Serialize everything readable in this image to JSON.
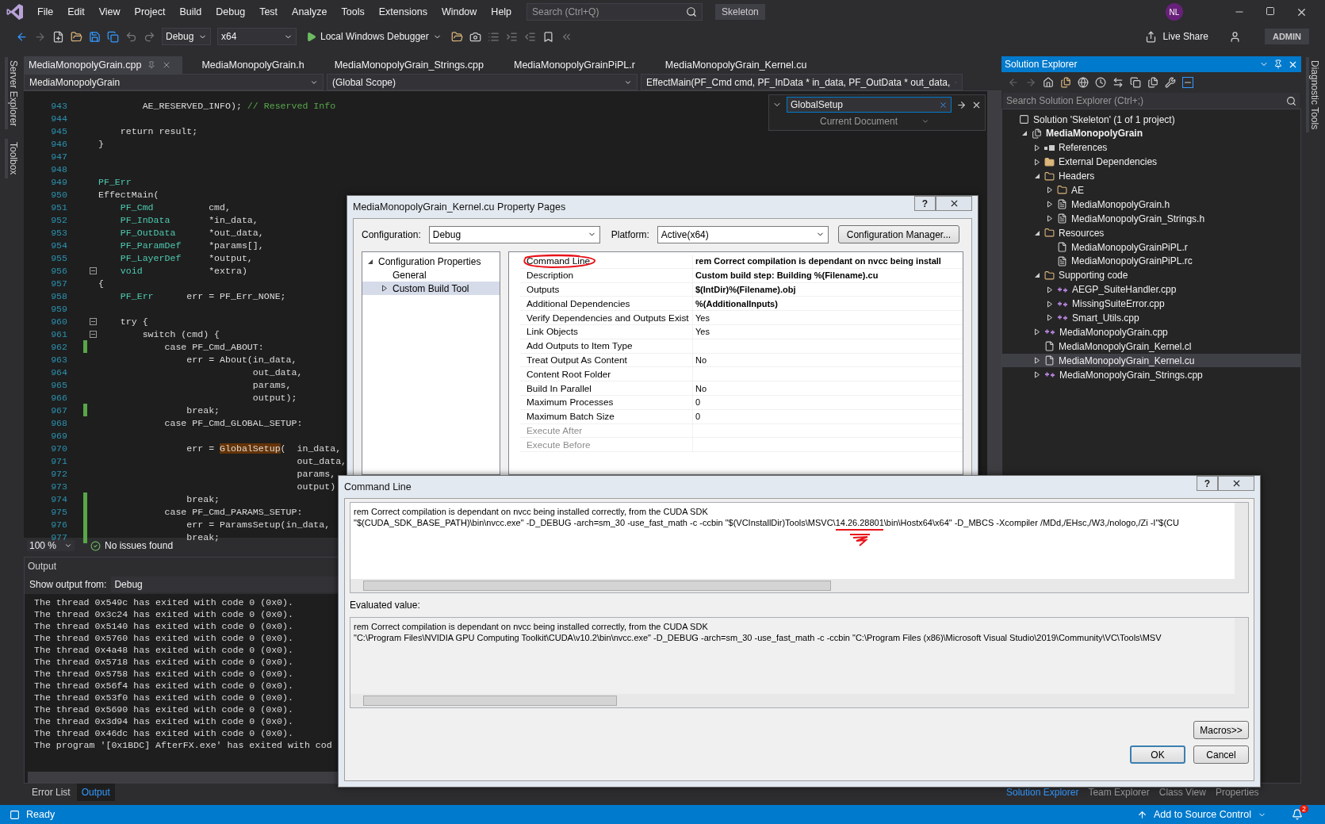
{
  "menu": [
    "File",
    "Edit",
    "View",
    "Project",
    "Build",
    "Debug",
    "Test",
    "Analyze",
    "Tools",
    "Extensions",
    "Window",
    "Help"
  ],
  "search": {
    "placeholder": "Search (Ctrl+Q)"
  },
  "solution_name": "Skeleton",
  "user_initials": "NL",
  "toolbar": {
    "configuration": "Debug",
    "platform": "x64",
    "debugger": "Local Windows Debugger",
    "live_share": "Live Share",
    "account": "ADMIN"
  },
  "left_rail": [
    "Server Explorer",
    "Toolbox"
  ],
  "right_rail": [
    "Diagnostic Tools"
  ],
  "editor_tabs": [
    {
      "label": "MediaMonopolyGrain.cpp",
      "selected": true
    },
    {
      "label": "MediaMonopolyGrain.h",
      "selected": false
    },
    {
      "label": "MediaMonopolyGrain_Strings.cpp",
      "selected": false
    },
    {
      "label": "MediaMonopolyGrainPiPL.r",
      "selected": false
    },
    {
      "label": "MediaMonopolyGrain_Kernel.cu",
      "selected": false
    }
  ],
  "nav_bar": {
    "project": "MediaMonopolyGrain",
    "scope": "(Global Scope)",
    "member": "EffectMain(PF_Cmd cmd, PF_InData * in_data, PF_OutData * out_data,"
  },
  "find": {
    "value": "GlobalSetup",
    "scope": "Current Document"
  },
  "code_lines": [
    {
      "number": "943",
      "fold": false,
      "changed": false,
      "segments": [
        {
          "kind": "plain",
          "text": "        AE_RESERVED_INFO); "
        },
        {
          "kind": "comment",
          "text": "// Reserved Info"
        }
      ]
    },
    {
      "number": "944",
      "fold": false,
      "changed": false
    },
    {
      "number": "945",
      "fold": false,
      "changed": false,
      "segments": [
        {
          "kind": "plain",
          "text": "    return result;"
        }
      ]
    },
    {
      "number": "946",
      "fold": false,
      "changed": false,
      "segments": [
        {
          "kind": "plain",
          "text": "}"
        }
      ]
    },
    {
      "number": "947",
      "fold": false,
      "changed": false
    },
    {
      "number": "948",
      "fold": false,
      "changed": false
    },
    {
      "number": "949",
      "fold": false,
      "changed": false,
      "segments": [
        {
          "kind": "type",
          "text": "PF_Err"
        }
      ]
    },
    {
      "number": "950",
      "fold": false,
      "changed": false,
      "segments": [
        {
          "kind": "plain",
          "text": "EffectMain("
        }
      ]
    },
    {
      "number": "951",
      "fold": false,
      "changed": false,
      "segments": [
        {
          "kind": "type",
          "text": "    PF_Cmd"
        },
        {
          "kind": "plain",
          "text": "          cmd,"
        }
      ]
    },
    {
      "number": "952",
      "fold": false,
      "changed": false,
      "segments": [
        {
          "kind": "type",
          "text": "    PF_InData"
        },
        {
          "kind": "plain",
          "text": "       *in_data,"
        }
      ]
    },
    {
      "number": "953",
      "fold": false,
      "changed": false,
      "segments": [
        {
          "kind": "type",
          "text": "    PF_OutData"
        },
        {
          "kind": "plain",
          "text": "      *out_data,"
        }
      ]
    },
    {
      "number": "954",
      "fold": false,
      "changed": false,
      "segments": [
        {
          "kind": "type",
          "text": "    PF_ParamDef"
        },
        {
          "kind": "plain",
          "text": "     *params[],"
        }
      ]
    },
    {
      "number": "955",
      "fold": false,
      "changed": false,
      "segments": [
        {
          "kind": "type",
          "text": "    PF_LayerDef"
        },
        {
          "kind": "plain",
          "text": "     *output,"
        }
      ]
    },
    {
      "number": "956",
      "fold": true,
      "changed": false,
      "segments": [
        {
          "kind": "type",
          "text": "    void"
        },
        {
          "kind": "plain",
          "text": "            *extra)"
        }
      ]
    },
    {
      "number": "957",
      "fold": false,
      "changed": false,
      "segments": [
        {
          "kind": "plain",
          "text": "{"
        }
      ]
    },
    {
      "number": "958",
      "fold": false,
      "changed": false,
      "segments": [
        {
          "kind": "type",
          "text": "    PF_Err"
        },
        {
          "kind": "plain",
          "text": "      err = PF_Err_NONE;"
        }
      ]
    },
    {
      "number": "959",
      "fold": false,
      "changed": false
    },
    {
      "number": "960",
      "fold": true,
      "changed": false,
      "segments": [
        {
          "kind": "plain",
          "text": "    try {"
        }
      ]
    },
    {
      "number": "961",
      "fold": true,
      "changed": false,
      "segments": [
        {
          "kind": "plain",
          "text": "        switch (cmd) {"
        }
      ]
    },
    {
      "number": "962",
      "fold": false,
      "changed": true,
      "segments": [
        {
          "kind": "plain",
          "text": "            case PF_Cmd_ABOUT:"
        }
      ]
    },
    {
      "number": "963",
      "fold": false,
      "changed": false,
      "segments": [
        {
          "kind": "plain",
          "text": "                err = About(in_data,"
        }
      ]
    },
    {
      "number": "964",
      "fold": false,
      "changed": false,
      "segments": [
        {
          "kind": "plain",
          "text": "                            out_data,"
        }
      ]
    },
    {
      "number": "965",
      "fold": false,
      "changed": false,
      "segments": [
        {
          "kind": "plain",
          "text": "                            params,"
        }
      ]
    },
    {
      "number": "966",
      "fold": false,
      "changed": false,
      "segments": [
        {
          "kind": "plain",
          "text": "                            output);"
        }
      ]
    },
    {
      "number": "967",
      "fold": false,
      "changed": true,
      "segments": [
        {
          "kind": "plain",
          "text": "                break;"
        }
      ]
    },
    {
      "number": "968",
      "fold": false,
      "changed": false,
      "segments": [
        {
          "kind": "plain",
          "text": "            case PF_Cmd_GLOBAL_SETUP:"
        }
      ]
    },
    {
      "number": "969",
      "fold": false,
      "changed": false
    },
    {
      "number": "970",
      "fold": false,
      "changed": false,
      "segments": [
        {
          "kind": "plain",
          "text": "                err = "
        },
        {
          "kind": "match",
          "text": "GlobalSetup"
        },
        {
          "kind": "plain",
          "text": "(  in_data,"
        }
      ]
    },
    {
      "number": "971",
      "fold": false,
      "changed": false,
      "segments": [
        {
          "kind": "plain",
          "text": "                                    out_data,"
        }
      ]
    },
    {
      "number": "972",
      "fold": false,
      "changed": false,
      "segments": [
        {
          "kind": "plain",
          "text": "                                    params,"
        }
      ]
    },
    {
      "number": "973",
      "fold": false,
      "changed": false,
      "segments": [
        {
          "kind": "plain",
          "text": "                                    output)"
        }
      ]
    },
    {
      "number": "974",
      "fold": false,
      "changed": true,
      "segments": [
        {
          "kind": "plain",
          "text": "                break;"
        }
      ]
    },
    {
      "number": "975",
      "fold": false,
      "changed": true,
      "segments": [
        {
          "kind": "plain",
          "text": "            case PF_Cmd_PARAMS_SETUP:"
        }
      ]
    },
    {
      "number": "976",
      "fold": false,
      "changed": true,
      "segments": [
        {
          "kind": "plain",
          "text": "                err = ParamsSetup(in_data,"
        }
      ]
    },
    {
      "number": "977",
      "fold": false,
      "changed": true,
      "segments": [
        {
          "kind": "plain",
          "text": "                break;"
        }
      ]
    }
  ],
  "editor_status": {
    "zoom": "100 %",
    "issues": "No issues found"
  },
  "output": {
    "title": "Output",
    "source_label": "Show output from:",
    "source": "Debug",
    "lines": [
      "The thread 0x549c has exited with code 0 (0x0).",
      "The thread 0x3c24 has exited with code 0 (0x0).",
      "The thread 0x5140 has exited with code 0 (0x0).",
      "The thread 0x5760 has exited with code 0 (0x0).",
      "The thread 0x4a48 has exited with code 0 (0x0).",
      "The thread 0x5718 has exited with code 0 (0x0).",
      "The thread 0x5758 has exited with code 0 (0x0).",
      "The thread 0x56f4 has exited with code 0 (0x0).",
      "The thread 0x53f0 has exited with code 0 (0x0).",
      "The thread 0x5690 has exited with code 0 (0x0).",
      "The thread 0x3d94 has exited with code 0 (0x0).",
      "The thread 0x46dc has exited with code 0 (0x0).",
      "The program '[0x1BDC] AfterFX.exe' has exited with cod"
    ]
  },
  "bottom_tabs": [
    {
      "label": "Error List",
      "selected": false
    },
    {
      "label": "Output",
      "selected": true
    }
  ],
  "solution_explorer": {
    "title": "Solution Explorer",
    "search_placeholder": "Search Solution Explorer (Ctrl+;)",
    "tree": [
      {
        "label": "Solution 'Skeleton' (1 of 1 project)",
        "kind": "solution",
        "expandable": false,
        "selected": false,
        "children": [
          {
            "label": "MediaMonopolyGrain",
            "kind": "project",
            "expandable": true,
            "expanded": true,
            "selected": false,
            "children": [
              {
                "label": "References",
                "kind": "references",
                "expandable": true,
                "expanded": false,
                "selected": false
              },
              {
                "label": "External Dependencies",
                "kind": "dependencies",
                "expandable": true,
                "expanded": false,
                "selected": false
              },
              {
                "label": "Headers",
                "kind": "filter",
                "expandable": true,
                "expanded": true,
                "selected": false,
                "children": [
                  {
                    "label": "AE",
                    "kind": "filter",
                    "expandable": true,
                    "expanded": false,
                    "selected": false
                  },
                  {
                    "label": "MediaMonopolyGrain.h",
                    "kind": "header",
                    "expandable": true,
                    "expanded": false,
                    "selected": false
                  },
                  {
                    "label": "MediaMonopolyGrain_Strings.h",
                    "kind": "header",
                    "expandable": true,
                    "expanded": false,
                    "selected": false
                  }
                ]
              },
              {
                "label": "Resources",
                "kind": "filter",
                "expandable": true,
                "expanded": true,
                "selected": false,
                "children": [
                  {
                    "label": "MediaMonopolyGrainPiPL.r",
                    "kind": "file",
                    "expandable": false,
                    "selected": false
                  },
                  {
                    "label": "MediaMonopolyGrainPiPL.rc",
                    "kind": "resource",
                    "expandable": false,
                    "selected": false
                  }
                ]
              },
              {
                "label": "Supporting code",
                "kind": "filter",
                "expandable": true,
                "expanded": true,
                "selected": false,
                "children": [
                  {
                    "label": "AEGP_SuiteHandler.cpp",
                    "kind": "cpp",
                    "expandable": true,
                    "expanded": false,
                    "selected": false
                  },
                  {
                    "label": "MissingSuiteError.cpp",
                    "kind": "cpp",
                    "expandable": true,
                    "expanded": false,
                    "selected": false
                  },
                  {
                    "label": "Smart_Utils.cpp",
                    "kind": "cpp",
                    "expandable": true,
                    "expanded": false,
                    "selected": false
                  }
                ]
              },
              {
                "label": "MediaMonopolyGrain.cpp",
                "kind": "cpp",
                "expandable": true,
                "expanded": false,
                "selected": false
              },
              {
                "label": "MediaMonopolyGrain_Kernel.cl",
                "kind": "file",
                "expandable": false,
                "selected": false
              },
              {
                "label": "MediaMonopolyGrain_Kernel.cu",
                "kind": "file",
                "expandable": true,
                "expanded": false,
                "selected": true
              },
              {
                "label": "MediaMonopolyGrain_Strings.cpp",
                "kind": "cpp",
                "expandable": true,
                "expanded": false,
                "selected": false
              }
            ]
          }
        ]
      }
    ]
  },
  "side_tabs": [
    {
      "label": "Solution Explorer",
      "selected": true
    },
    {
      "label": "Team Explorer",
      "selected": false
    },
    {
      "label": "Class View",
      "selected": false
    },
    {
      "label": "Properties",
      "selected": false
    }
  ],
  "status_bar": {
    "text": "Ready",
    "source_control": "Add to Source Control",
    "notifications": "2"
  },
  "property_pages": {
    "title": "MediaMonopolyGrain_Kernel.cu Property Pages",
    "help": "?",
    "configuration_label": "Configuration:",
    "configuration": "Debug",
    "platform_label": "Platform:",
    "platform": "Active(x64)",
    "manager_button": "Configuration Manager...",
    "tree": [
      {
        "label": "Configuration Properties",
        "expandable": true,
        "expanded": true,
        "selected": false,
        "children": [
          {
            "label": "General",
            "expandable": false,
            "selected": false
          },
          {
            "label": "Custom Build Tool",
            "expandable": true,
            "expanded": false,
            "selected": true
          }
        ]
      }
    ],
    "properties": [
      {
        "name": "Command Line",
        "value": "rem Correct compilation is dependant on nvcc being install",
        "bold": true,
        "disabled": false,
        "circled": true
      },
      {
        "name": "Description",
        "value": "Custom build step: Building %(Filename).cu",
        "bold": true,
        "disabled": false,
        "circled": false
      },
      {
        "name": "Outputs",
        "value": "$(IntDir)%(Filename).obj",
        "bold": true,
        "disabled": false,
        "circled": false
      },
      {
        "name": "Additional Dependencies",
        "value": "%(AdditionalInputs)",
        "bold": true,
        "disabled": false,
        "circled": false
      },
      {
        "name": "Verify Dependencies and Outputs Exist",
        "value": "Yes",
        "bold": false,
        "disabled": false,
        "circled": false
      },
      {
        "name": "Link Objects",
        "value": "Yes",
        "bold": false,
        "disabled": false,
        "circled": false
      },
      {
        "name": "Add Outputs to Item Type",
        "disabled": false,
        "circled": false
      },
      {
        "name": "Treat Output As Content",
        "value": "No",
        "bold": false,
        "disabled": false,
        "circled": false
      },
      {
        "name": "Content Root Folder",
        "disabled": false,
        "circled": false
      },
      {
        "name": "Build In Parallel",
        "value": "No",
        "bold": false,
        "disabled": false,
        "circled": false
      },
      {
        "name": "Maximum Processes",
        "value": "0",
        "bold": false,
        "disabled": false,
        "circled": false
      },
      {
        "name": "Maximum Batch Size",
        "value": "0",
        "bold": false,
        "disabled": false,
        "circled": false
      },
      {
        "name": "Execute After",
        "disabled": true,
        "circled": false
      },
      {
        "name": "Execute Before",
        "disabled": true,
        "circled": false
      }
    ]
  },
  "command_line": {
    "title": "Command Line",
    "help": "?",
    "value_lines": [
      {
        "segments": [
          {
            "text": "rem Correct compilation is dependant on nvcc being installed correctly, from the CUDA SDK"
          }
        ]
      },
      {
        "segments": [
          {
            "text": "\"$(CUDA_SDK_BASE_PATH)\\bin\\nvcc.exe\" -D_DEBUG -arch=sm_30 -use_fast_math -c -ccbin \"$(VCInstallDir)Tools\\MSVC\\"
          },
          {
            "text": "14.26.28801",
            "marked": true
          },
          {
            "text": "\\bin\\Hostx64\\x64\" -D_MBCS -Xcompiler /MDd,/EHsc,/W3,/nologo,/Zi -I\"$(CU"
          }
        ]
      }
    ],
    "evaluated_label": "Evaluated value:",
    "evaluated_lines": [
      "rem Correct compilation is dependant on nvcc being installed correctly, from the CUDA SDK",
      "\"C:\\Program Files\\NVIDIA GPU Computing Toolkit\\CUDA\\v10.2\\bin\\nvcc.exe\" -D_DEBUG -arch=sm_30 -use_fast_math -c -ccbin \"C:\\Program Files (x86)\\Microsoft Visual Studio\\2019\\Community\\VC\\Tools\\MSV"
    ],
    "macros_button": "Macros>>",
    "ok_button": "OK",
    "cancel_button": "Cancel"
  }
}
